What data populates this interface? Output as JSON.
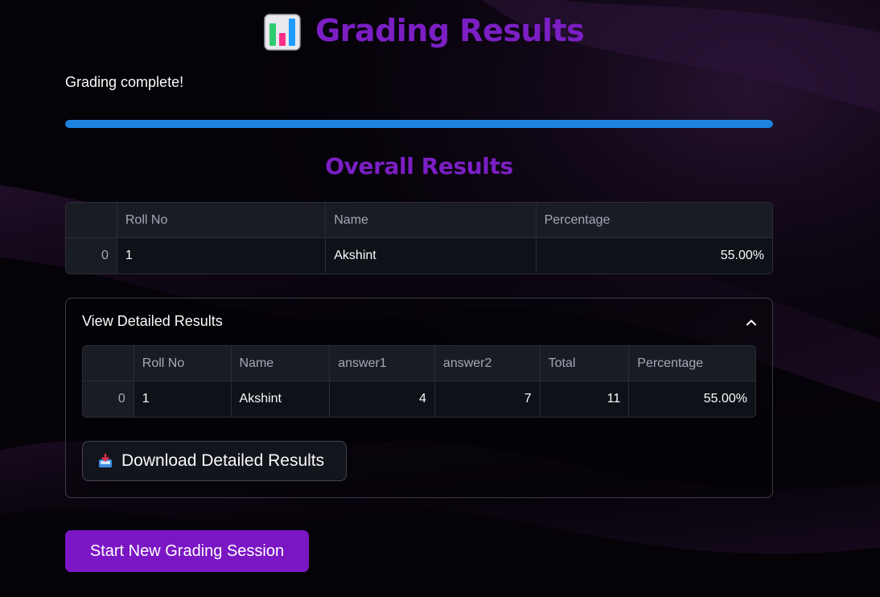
{
  "header": {
    "icon": "bar-chart-icon",
    "title": "Grading Results"
  },
  "status": {
    "message": "Grading complete!",
    "progress_percent": 100,
    "progress_color": "#1c83e1"
  },
  "overall": {
    "heading": "Overall Results",
    "columns": [
      "",
      "Roll No",
      "Name",
      "Percentage"
    ],
    "rows": [
      {
        "index": "0",
        "roll_no": "1",
        "name": "Akshint",
        "percentage": "55.00%"
      }
    ]
  },
  "details": {
    "expander_label": "View Detailed Results",
    "expanded": true,
    "toggle_icon": "chevron-up-icon",
    "columns": [
      "",
      "Roll No",
      "Name",
      "answer1",
      "answer2",
      "Total",
      "Percentage"
    ],
    "rows": [
      {
        "index": "0",
        "roll_no": "1",
        "name": "Akshint",
        "answer1": "4",
        "answer2": "7",
        "total": "11",
        "percentage": "55.00%"
      }
    ],
    "download_button": {
      "icon": "inbox-tray-icon",
      "label": "Download Detailed Results"
    }
  },
  "actions": {
    "new_session_label": "Start New Grading Session",
    "accent_color": "#7b16c4"
  },
  "theme": {
    "title_color": "#7b1fc4",
    "background": "#050208"
  }
}
